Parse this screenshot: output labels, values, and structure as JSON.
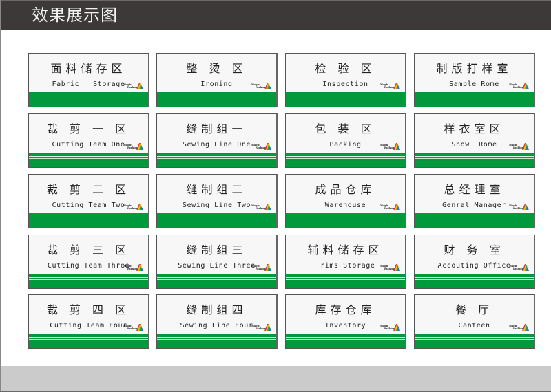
{
  "header": {
    "title": "效果展示图"
  },
  "colors": {
    "header_bg": "#3d3938",
    "band_green": "#009a3c",
    "card_bg": "#f6f7f6",
    "footer_bg": "#cbcbcb"
  },
  "logo": {
    "line1": "Magic",
    "line2": "Fashion",
    "icon": "rainbow-a-logo-icon"
  },
  "signs": [
    {
      "zh": "面料储存区",
      "en": "Fabric   Storage"
    },
    {
      "zh": "整 烫 区",
      "en": "Ironing"
    },
    {
      "zh": "检 验 区",
      "en": "Inspection"
    },
    {
      "zh": "制版打样室",
      "en": "Sample Rome"
    },
    {
      "zh": "裁 剪 一 区",
      "en": "Cutting Team One"
    },
    {
      "zh": "缝制组一",
      "en": "Sewing Line One"
    },
    {
      "zh": "包 装 区",
      "en": "Packing"
    },
    {
      "zh": "样衣室区",
      "en": "Show  Rome"
    },
    {
      "zh": "裁 剪 二 区",
      "en": "Cutting Team Two"
    },
    {
      "zh": "缝制组二",
      "en": "Sewing Line Two"
    },
    {
      "zh": "成品仓库",
      "en": "Warehouse"
    },
    {
      "zh": "总经理室",
      "en": "Genral Manager"
    },
    {
      "zh": "裁 剪 三 区",
      "en": "Cutting Team Three"
    },
    {
      "zh": "缝制组三",
      "en": "Sewing Line Three"
    },
    {
      "zh": "辅料储存区",
      "en": "Trims Storage"
    },
    {
      "zh": "财  务  室",
      "en": "Accouting Office"
    },
    {
      "zh": "裁 剪 四 区",
      "en": "Cutting Team Four"
    },
    {
      "zh": "缝制组四",
      "en": "Sewing Line Four"
    },
    {
      "zh": "库存仓库",
      "en": "Inventory"
    },
    {
      "zh": "餐   厅",
      "en": "Canteen"
    }
  ]
}
